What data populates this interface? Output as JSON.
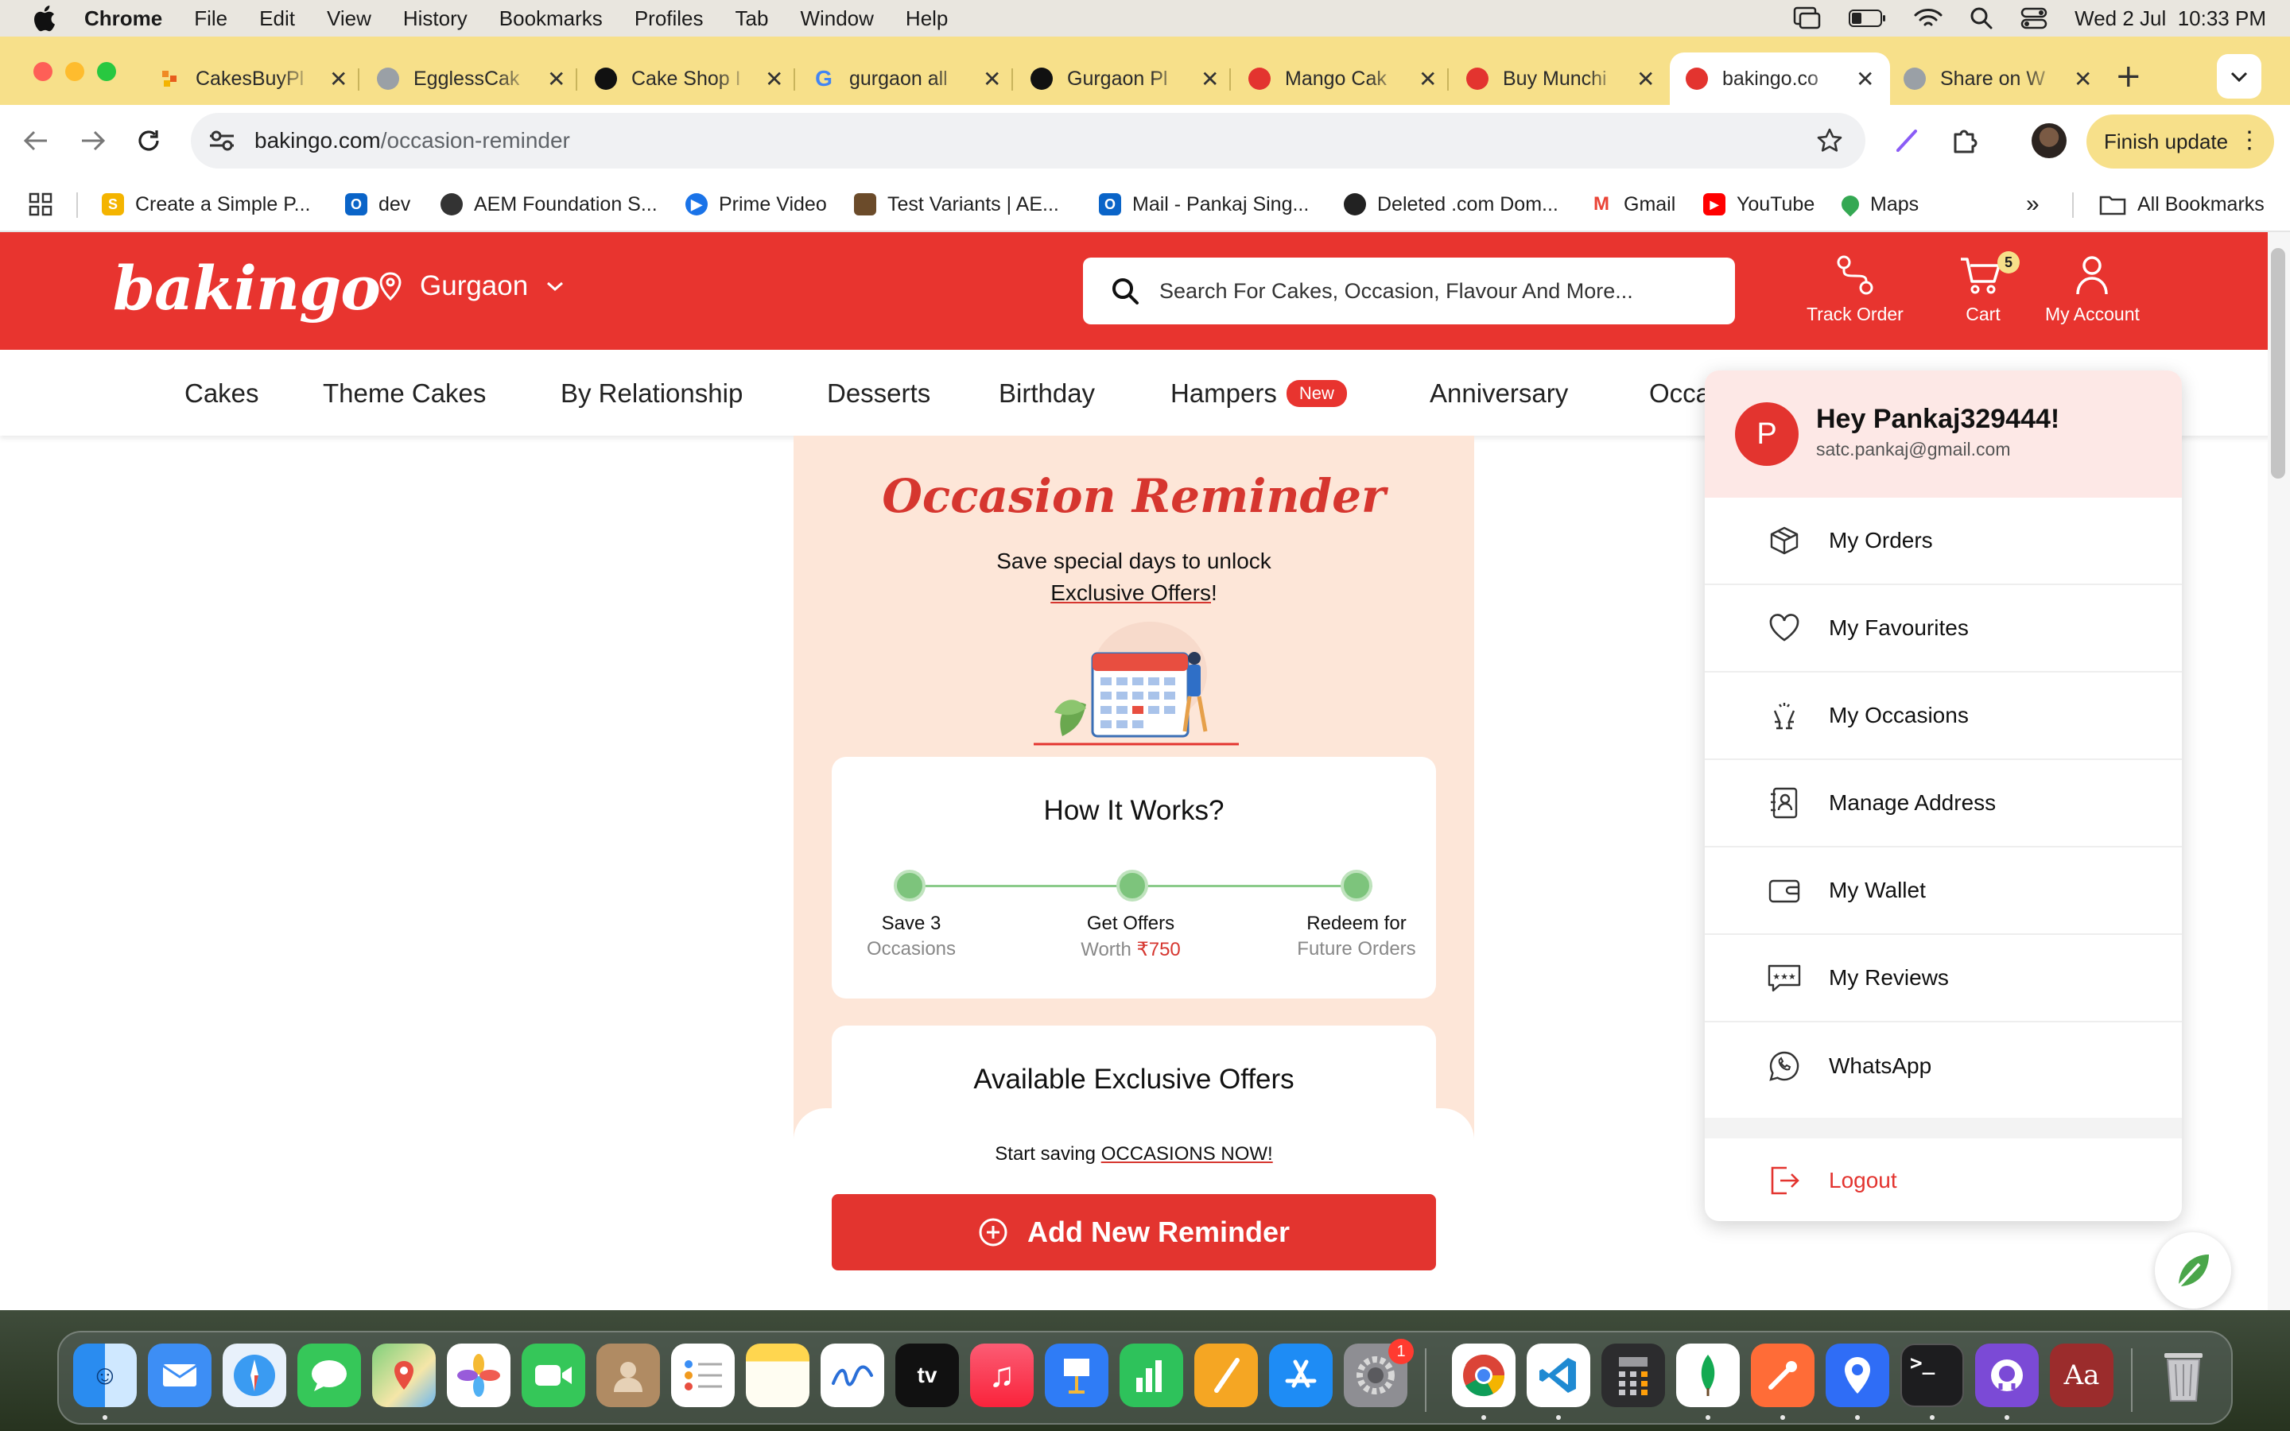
{
  "menubar": {
    "app": "Chrome",
    "items": [
      "File",
      "Edit",
      "View",
      "History",
      "Bookmarks",
      "Profiles",
      "Tab",
      "Window",
      "Help"
    ],
    "datetime": "Wed 2 Jul  10:33 PM"
  },
  "tabs": [
    {
      "label": "CakesBuyPl",
      "icon": "cakesbuy-favicon",
      "color": "#f08a24"
    },
    {
      "label": "EgglessCak",
      "icon": "globe-favicon",
      "color": "#9aa0a6"
    },
    {
      "label": "Cake Shop I",
      "icon": "openai-favicon",
      "color": "#111111"
    },
    {
      "label": "gurgaon all",
      "icon": "google-favicon",
      "color": "#4285f4"
    },
    {
      "label": "Gurgaon Pl",
      "icon": "openai-favicon",
      "color": "#111111"
    },
    {
      "label": "Mango Cak",
      "icon": "bakingo-favicon",
      "color": "#e3342f"
    },
    {
      "label": "Buy Munchi",
      "icon": "bakingo-favicon",
      "color": "#e3342f"
    },
    {
      "label": "bakingo.co",
      "icon": "bakingo-favicon",
      "color": "#e3342f",
      "active": true
    },
    {
      "label": "Share on W",
      "icon": "share-favicon",
      "color": "#9aa0a6"
    }
  ],
  "toolbar": {
    "url_host": "bakingo.com",
    "url_path": "/occasion-reminder",
    "finish_update": "Finish update"
  },
  "bookmarks": [
    {
      "label": "Create a Simple P...",
      "icon": "s-favicon",
      "color": "#f4b400"
    },
    {
      "label": "dev",
      "icon": "outlook-favicon",
      "color": "#0a64c8"
    },
    {
      "label": "AEM Foundation S...",
      "icon": "globe-favicon",
      "color": "#333333"
    },
    {
      "label": "Prime Video",
      "icon": "prime-favicon",
      "color": "#1a73e8"
    },
    {
      "label": "Test Variants | AE...",
      "icon": "test-favicon",
      "color": "#6b4b2a"
    },
    {
      "label": "Mail - Pankaj Sing...",
      "icon": "outlook-favicon",
      "color": "#0a64c8"
    },
    {
      "label": "Deleted .com Dom...",
      "icon": "deleted-favicon",
      "color": "#222222"
    },
    {
      "label": "Gmail",
      "icon": "gmail-favicon",
      "color": "#ea4335"
    },
    {
      "label": "YouTube",
      "icon": "youtube-favicon",
      "color": "#ff0000"
    },
    {
      "label": "Maps",
      "icon": "maps-favicon",
      "color": "#34a853"
    }
  ],
  "all_bookmarks": "All Bookmarks",
  "site": {
    "logo": "bakingo",
    "location": "Gurgaon",
    "search_placeholder": "Search For Cakes, Occasion, Flavour And More...",
    "track_order": "Track Order",
    "cart": "Cart",
    "cart_count": "5",
    "my_account": "My Account",
    "brand_color": "#e8342f"
  },
  "categories": [
    "Cakes",
    "Theme Cakes",
    "By Relationship",
    "Desserts",
    "Birthday",
    "Hampers",
    "Anniversary",
    "Occa"
  ],
  "hampers_badge": "New",
  "reminder": {
    "title": "Occasion Reminder",
    "subtitle_line1": "Save special days to unlock",
    "subtitle_line2": "Exclusive Offers",
    "subtitle_end": "!",
    "how_title": "How It Works?",
    "steps": [
      {
        "t1": "Save 3",
        "t2": "Occasions"
      },
      {
        "t1": "Get Offers",
        "t2": "Worth ",
        "amount": "₹750"
      },
      {
        "t1": "Redeem for",
        "t2": "Future Orders"
      }
    ],
    "offers_title": "Available Exclusive Offers",
    "cta_prefix": "Start saving ",
    "cta_highlight": "OCCASIONS NOW!",
    "add_button": "Add New Reminder"
  },
  "account_menu": {
    "avatar_letter": "P",
    "greeting": "Hey Pankaj329444!",
    "email": "satc.pankaj@gmail.com",
    "items": [
      {
        "label": "My Orders",
        "icon": "box-icon"
      },
      {
        "label": "My Favourites",
        "icon": "heart-icon"
      },
      {
        "label": "My Occasions",
        "icon": "celebration-icon"
      },
      {
        "label": "Manage Address",
        "icon": "address-book-icon"
      },
      {
        "label": "My Wallet",
        "icon": "wallet-icon"
      },
      {
        "label": "My Reviews",
        "icon": "review-icon"
      },
      {
        "label": "WhatsApp",
        "icon": "whatsapp-icon"
      }
    ],
    "logout": "Logout"
  },
  "dock": {
    "calendar_badge": "1",
    "apps": [
      "Finder",
      "Mail",
      "Safari",
      "Messages",
      "Maps",
      "Photos",
      "FaceTime",
      "Contacts",
      "Reminders",
      "Notes",
      "Freeform",
      "TV",
      "Music",
      "Keynote",
      "Numbers",
      "Pages",
      "App Store",
      "System Settings",
      "Chrome",
      "VS Code",
      "Calculator",
      "MongoDB Compass",
      "Postman",
      "Proxyman",
      "Terminal",
      "GitHub Desktop",
      "Dictionary",
      "Trash"
    ]
  }
}
